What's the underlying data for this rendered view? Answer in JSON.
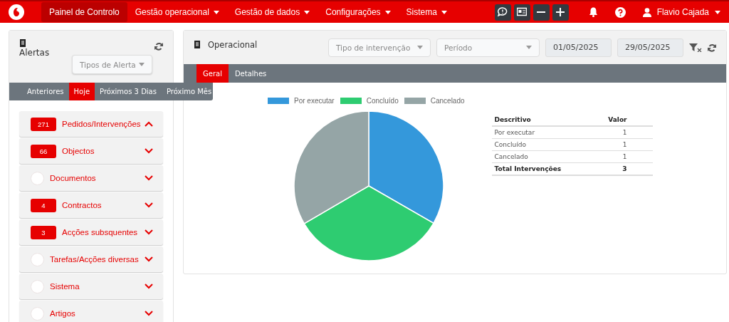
{
  "navbar": {
    "items": [
      {
        "label": "Painel de Controlo",
        "selected": true,
        "dropdown": false
      },
      {
        "label": "Gestão operacional",
        "selected": false,
        "dropdown": true
      },
      {
        "label": "Gestão de dados",
        "selected": false,
        "dropdown": true
      },
      {
        "label": "Configurações",
        "selected": false,
        "dropdown": true
      },
      {
        "label": "Sistema",
        "selected": false,
        "dropdown": true
      }
    ],
    "user": "Flavio Cajada"
  },
  "alerts": {
    "title": "Alertas",
    "filter": {
      "placeholder": "Tipos de Alerta"
    },
    "tabs": [
      {
        "label": "Anteriores",
        "selected": false
      },
      {
        "label": "Hoje",
        "selected": true
      },
      {
        "label": "Próximos 3 Dias",
        "selected": false
      },
      {
        "label": "Próximo Mês",
        "selected": false
      }
    ],
    "items": [
      {
        "label": "Pedidos/Intervenções",
        "count": "271",
        "expanded": true
      },
      {
        "label": "Objectos",
        "count": "66",
        "expanded": false
      },
      {
        "label": "Documentos",
        "expanded": false
      },
      {
        "label": "Contractos",
        "count": "4",
        "expanded": false
      },
      {
        "label": "Acções subsquentes",
        "count": "3",
        "expanded": false
      },
      {
        "label": "Tarefas/Acções diversas",
        "expanded": false
      },
      {
        "label": "Sistema",
        "expanded": false
      },
      {
        "label": "Artigos",
        "expanded": false
      }
    ]
  },
  "operational": {
    "title": "Operacional",
    "type_filter": {
      "placeholder": "Tipo de intervenção"
    },
    "period_filter": {
      "placeholder": "Período"
    },
    "date_from": "01/05/2025",
    "date_to": "29/05/2025",
    "tabs": [
      {
        "label": "Geral",
        "selected": true
      },
      {
        "label": "Detalhes",
        "selected": false
      }
    ],
    "chart_data": {
      "type": "pie",
      "legend": "top",
      "categories": [
        "Por executar",
        "Concluído",
        "Cancelado"
      ],
      "values": [
        33.3,
        33.3,
        33.4
      ],
      "colors": [
        "#3498db",
        "#2ecc71",
        "#95a5a6"
      ]
    },
    "table": {
      "columns": [
        "Descritivo",
        "Valor"
      ],
      "rows": [
        {
          "cells": [
            "Por executar",
            "1"
          ],
          "total": false
        },
        {
          "cells": [
            "Concluído",
            "1"
          ],
          "total": false
        },
        {
          "cells": [
            "Cancelado",
            "1"
          ],
          "total": false
        },
        {
          "cells": [
            "Total Intervenções",
            "3"
          ],
          "total": true
        }
      ]
    }
  }
}
